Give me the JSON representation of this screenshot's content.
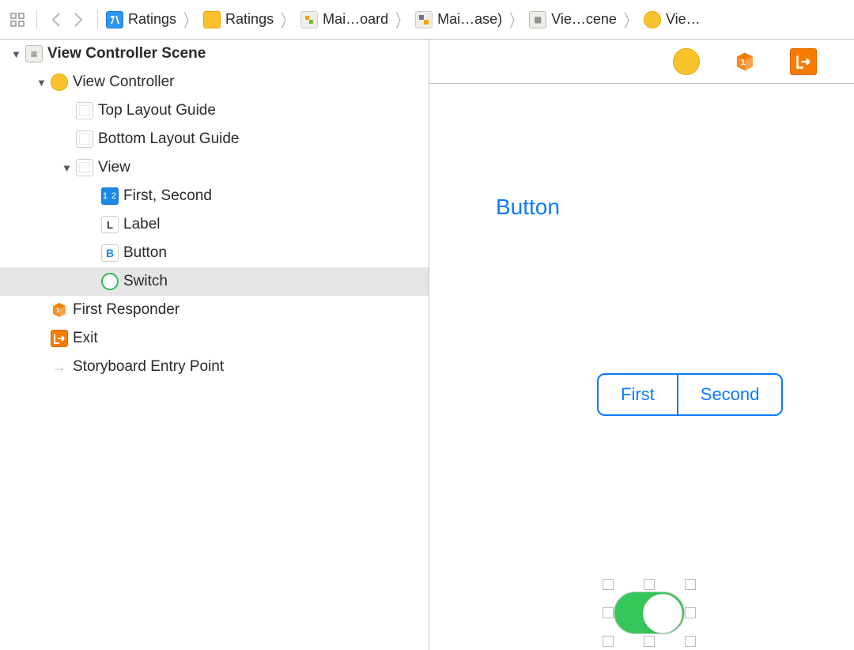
{
  "breadcrumb": [
    {
      "label": "Ratings",
      "icon": "app"
    },
    {
      "label": "Ratings",
      "icon": "folder"
    },
    {
      "label": "Mai…oard",
      "icon": "storyboard1"
    },
    {
      "label": "Mai…ase)",
      "icon": "storyboard2"
    },
    {
      "label": "Vie…cene",
      "icon": "scene"
    },
    {
      "label": "Vie…",
      "icon": "vcircle",
      "truncated": true
    }
  ],
  "outline": {
    "scene": {
      "label": "View Controller Scene"
    },
    "vc": {
      "label": "View Controller"
    },
    "topGuide": {
      "label": "Top Layout Guide"
    },
    "bottomGuide": {
      "label": "Bottom Layout Guide"
    },
    "view": {
      "label": "View"
    },
    "segmented": {
      "label": "First, Second"
    },
    "label": {
      "label": "Label"
    },
    "button": {
      "label": "Button"
    },
    "switch": {
      "label": "Switch",
      "selected": true
    },
    "firstResp": {
      "label": "First Responder"
    },
    "exit": {
      "label": "Exit"
    },
    "entry": {
      "label": "Storyboard Entry Point"
    }
  },
  "canvas": {
    "button_title": "Button",
    "segments": [
      "First",
      "Second"
    ],
    "switch_on": true
  },
  "colors": {
    "tint": "#0a7aff",
    "switch_on": "#35c759",
    "orange": "#f57c00",
    "yellow": "#f8c32c"
  }
}
